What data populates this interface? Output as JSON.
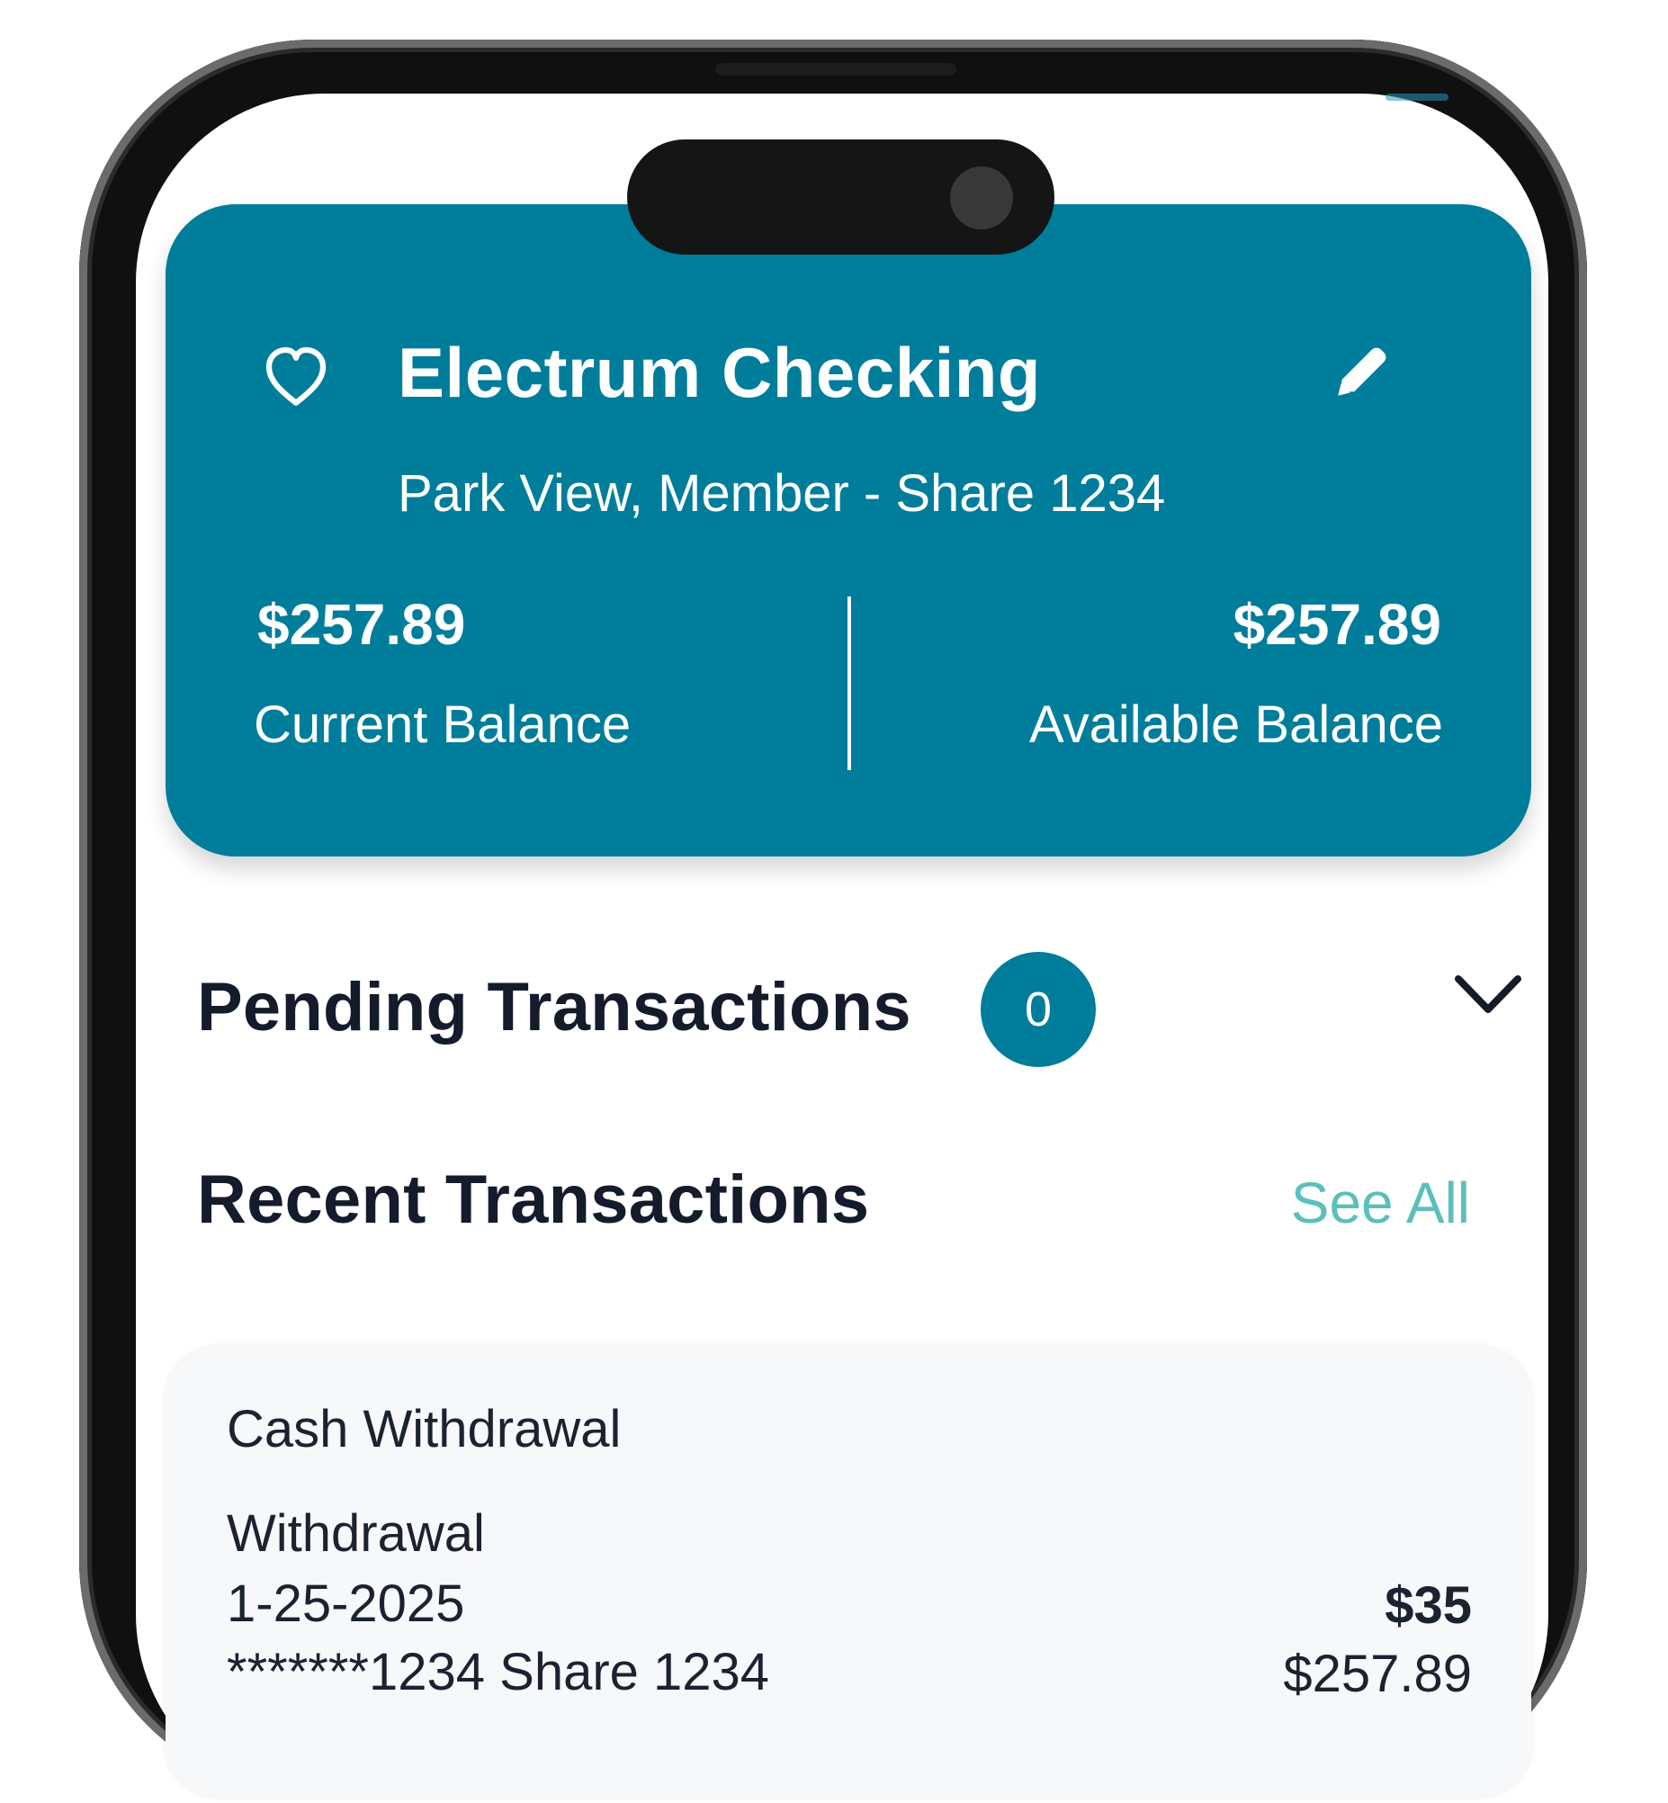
{
  "colors": {
    "brand": "#007d9b",
    "accent": "#5bbfbc",
    "text_dark": "#141b2b",
    "card_bg": "#f7f8fa"
  },
  "account": {
    "favorite_icon": "heart-outline-icon",
    "title": "Electrum Checking",
    "edit_icon": "pencil-icon",
    "subtitle": "Park View, Member - Share 1234",
    "current_balance": "$257.89",
    "current_balance_label": "Current Balance",
    "available_balance": "$257.89",
    "available_balance_label": "Available Balance"
  },
  "pending": {
    "title": "Pending Transactions",
    "count": "0",
    "toggle_icon": "chevron-down-icon"
  },
  "recent": {
    "title": "Recent Transactions",
    "see_all_label": "See All",
    "transactions": [
      {
        "title": "Cash Withdrawal",
        "type": "Withdrawal",
        "date": "1-25-2025",
        "account": "*******1234 Share 1234",
        "amount": "$35",
        "balance": "$257.89"
      }
    ]
  }
}
